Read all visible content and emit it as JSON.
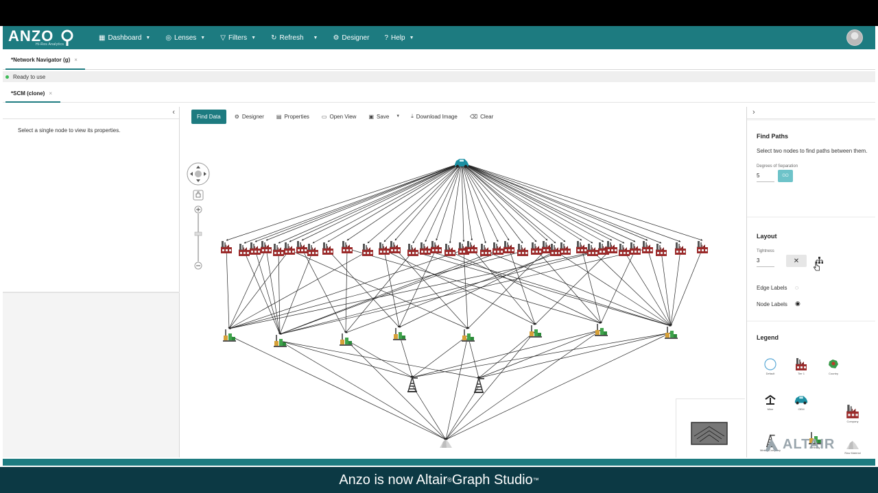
{
  "app": {
    "logo_text": "ANZO",
    "logo_sub": "Hi-Res Analytics"
  },
  "nav": [
    {
      "label": "Dashboard",
      "icon": "dashboard-icon",
      "dropdown": true
    },
    {
      "label": "Lenses",
      "icon": "lens-icon",
      "dropdown": true
    },
    {
      "label": "Filters",
      "icon": "filter-icon",
      "dropdown": true
    },
    {
      "label": "Refresh",
      "icon": "refresh-icon",
      "dropdown": true
    },
    {
      "label": "Designer",
      "icon": "gear-icon",
      "dropdown": false
    },
    {
      "label": "Help",
      "icon": "help-icon",
      "dropdown": true
    }
  ],
  "tabs1": {
    "active": "*Network Navigator (g)"
  },
  "status": {
    "text": "Ready to use"
  },
  "tabs2": {
    "active": "*SCM (clone)"
  },
  "left_panel": {
    "message": "Select a single node to view its properties."
  },
  "toolbar": {
    "find_data": "Find Data",
    "designer": "Designer",
    "properties": "Properties",
    "open_view": "Open View",
    "save": "Save",
    "download_image": "Download Image",
    "clear": "Clear"
  },
  "right_panel": {
    "find_paths_title": "Find Paths",
    "find_paths_desc": "Select two nodes to find paths between them.",
    "degrees_label": "Degrees of Separation",
    "degrees_value": "5",
    "go_label": "GO",
    "layout_title": "Layout",
    "tightness_label": "Tightness",
    "tightness_value": "3",
    "edge_labels": "Edge Labels",
    "node_labels": "Node Labels",
    "legend_title": "Legend",
    "legend": [
      {
        "label": "Default",
        "icon": "circle-icon"
      },
      {
        "label": "Tier 1",
        "icon": "factory-icon"
      },
      {
        "label": "Country",
        "icon": "country-icon"
      },
      {
        "label": "Mine",
        "icon": "mine-icon"
      },
      {
        "label": "OEM",
        "icon": "car-icon"
      },
      {
        "label": "Company",
        "icon": "company-icon"
      },
      {
        "label": "Mining Company",
        "icon": "oil-derrick-icon"
      },
      {
        "label": "Refinery",
        "icon": "refinery-icon"
      },
      {
        "label": "Raw Material",
        "icon": "raw-material-icon"
      }
    ],
    "brand": "ALTAIR"
  },
  "banner": {
    "text_main": "Anzo is now Altair",
    "text_end": " Graph Studio",
    "reg": "®",
    "tm": "™"
  },
  "colors": {
    "primary": "#1d7b80",
    "banner": "#0c3944",
    "go": "#6ec3c9",
    "status_dot": "#3dbb56"
  }
}
